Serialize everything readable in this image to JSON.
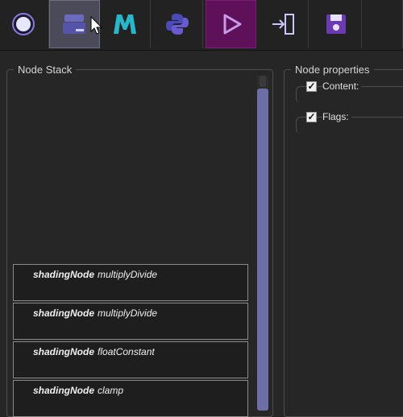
{
  "toolbar": {
    "buttons": [
      {
        "name": "record",
        "icon": "circle-icon"
      },
      {
        "name": "node-editor",
        "icon": "node-stack-icon",
        "state": "hover"
      },
      {
        "name": "maya",
        "icon": "maya-m-icon"
      },
      {
        "name": "python",
        "icon": "python-icon"
      },
      {
        "name": "run",
        "icon": "play-icon",
        "state": "active"
      },
      {
        "name": "import",
        "icon": "import-icon"
      },
      {
        "name": "save",
        "icon": "save-icon"
      },
      {
        "name": "extra",
        "icon": ""
      }
    ]
  },
  "node_stack": {
    "title": "Node Stack",
    "items": [
      {
        "type": "shadingNode",
        "name": "multiplyDivide"
      },
      {
        "type": "shadingNode",
        "name": "multiplyDivide"
      },
      {
        "type": "shadingNode",
        "name": "floatConstant"
      },
      {
        "type": "shadingNode",
        "name": "clamp"
      }
    ]
  },
  "node_properties": {
    "title": "Node properties",
    "sections": [
      {
        "label": "Content:",
        "checked": true
      },
      {
        "label": "Flags:",
        "checked": true
      }
    ]
  },
  "colors": {
    "accent_purple": "#6e6ea6",
    "active_button": "#5e1058"
  }
}
